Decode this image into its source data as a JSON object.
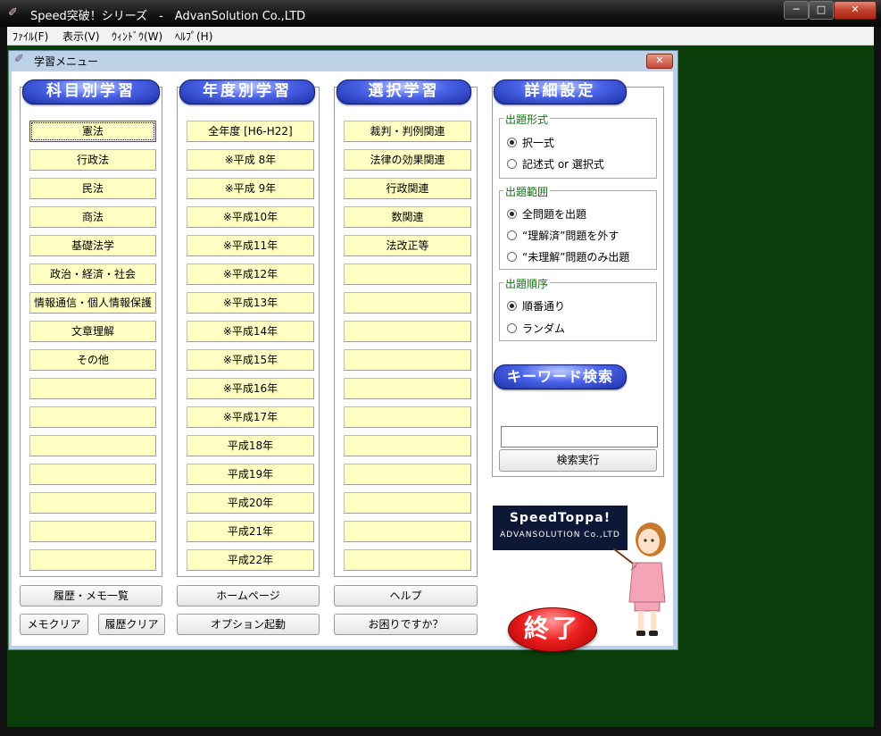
{
  "window": {
    "title": "Speed突破！シリーズ　-　AdvanSolution Co.,LTD",
    "controls": {
      "minimize": "─",
      "maximize": "□",
      "close": "✕"
    }
  },
  "menubar": {
    "items": [
      "ﾌｧｲﾙ(F)",
      "表示(V)",
      "ｳｨﾝﾄﾞｳ(W)",
      "ﾍﾙﾌﾟ(H)"
    ]
  },
  "child_window": {
    "title": "学習メニュー",
    "close": "✕"
  },
  "subject": {
    "header": "科目別学習",
    "buttons": [
      "憲法",
      "行政法",
      "民法",
      "商法",
      "基礎法学",
      "政治・経済・社会",
      "情報通信・個人情報保護",
      "文章理解",
      "その他",
      "",
      "",
      "",
      "",
      "",
      "",
      ""
    ]
  },
  "year": {
    "header": "年度別学習",
    "buttons": [
      "全年度 [H6-H22]",
      "※平成 8年",
      "※平成 9年",
      "※平成10年",
      "※平成11年",
      "※平成12年",
      "※平成13年",
      "※平成14年",
      "※平成15年",
      "※平成16年",
      "※平成17年",
      "平成18年",
      "平成19年",
      "平成20年",
      "平成21年",
      "平成22年"
    ]
  },
  "selection": {
    "header": "選択学習",
    "buttons": [
      "裁判・判例関連",
      "法律の効果関連",
      "行政関連",
      "数関連",
      "法改正等",
      "",
      "",
      "",
      "",
      "",
      "",
      "",
      "",
      "",
      "",
      ""
    ]
  },
  "detail": {
    "header": "詳細設定",
    "format": {
      "label": "出題形式",
      "options": [
        "択一式",
        "記述式 or 選択式"
      ],
      "selected": 0
    },
    "range": {
      "label": "出題範囲",
      "options": [
        "全問題を出題",
        "“理解済”問題を外す",
        "“未理解”問題のみ出題"
      ],
      "selected": 0
    },
    "order": {
      "label": "出題順序",
      "options": [
        "順番通り",
        "ランダム"
      ],
      "selected": 0
    }
  },
  "keyword": {
    "header": "キーワード検索",
    "value": "",
    "search_button": "検索実行"
  },
  "bottom_buttons": {
    "history_memo": "履歴・メモ一覧",
    "memo_clear": "メモクリア",
    "history_clear": "履歴クリア",
    "homepage": "ホームページ",
    "option_start": "オプション起動",
    "help": "ヘルプ",
    "trouble": "お困りですか？"
  },
  "logo": {
    "main": "SpeedToppa!",
    "sub": "ADVANSOLUTION Co.,LTD"
  },
  "exit_button": "終了",
  "colors": {
    "mdi_background": "#0a3d0a",
    "yellow_button": "#ffffc4",
    "header_blue": "#1c2fa8",
    "exit_red": "#ee2020"
  }
}
